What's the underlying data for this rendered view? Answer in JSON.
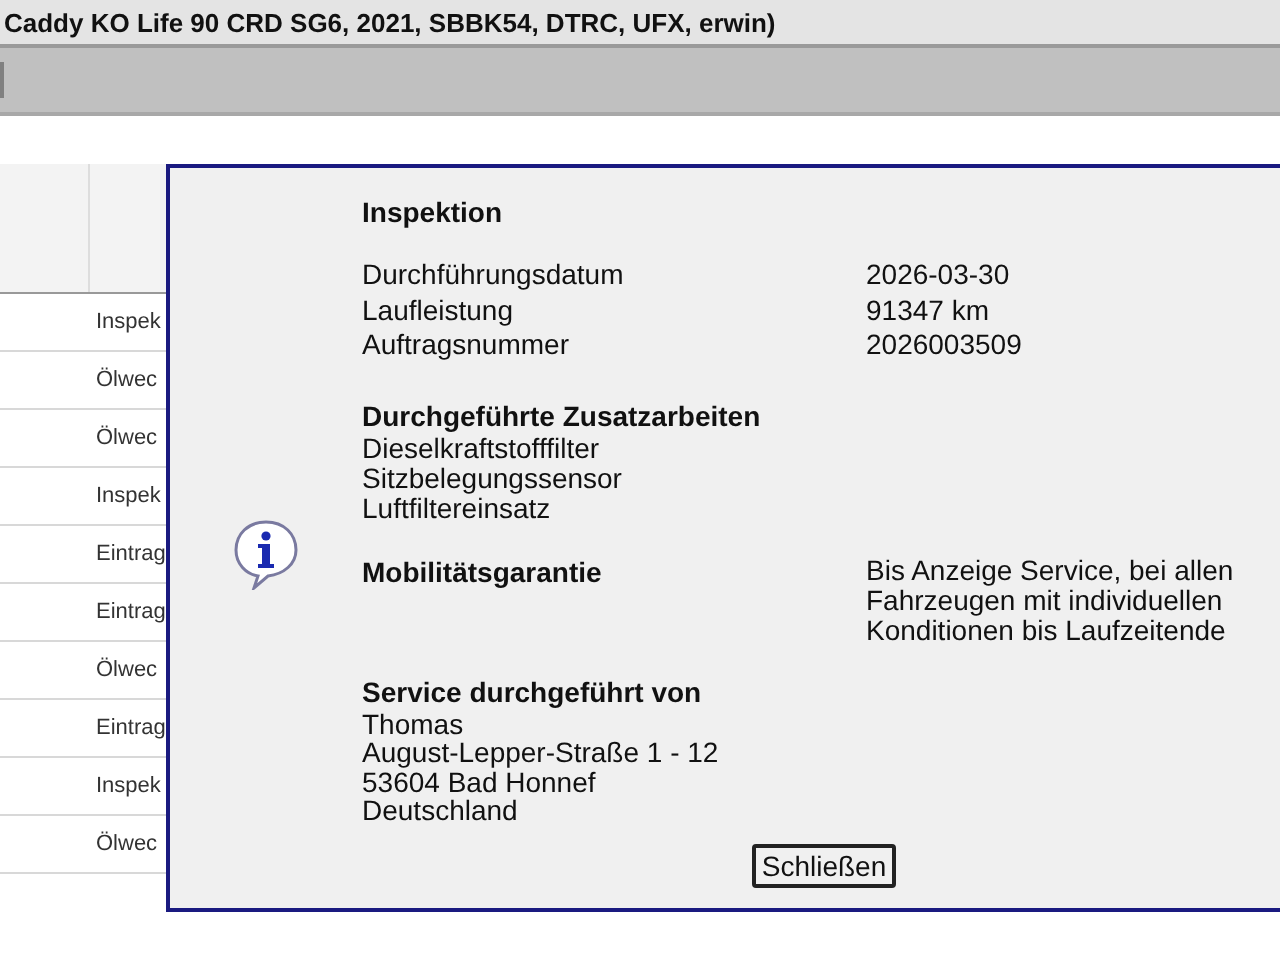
{
  "window": {
    "title": "Caddy KO Life 90 CRD SG6, 2021, SBBK54, DTRC, UFX, erwin)"
  },
  "table": {
    "rows": [
      {
        "entry": "Inspek"
      },
      {
        "entry": "Ölwec"
      },
      {
        "entry": "Ölwec"
      },
      {
        "entry": "Inspek"
      },
      {
        "entry": "Eintrag"
      },
      {
        "entry": "Eintrag"
      },
      {
        "entry": "Ölwec"
      },
      {
        "entry": "Eintrag"
      },
      {
        "entry": "Inspek"
      },
      {
        "entry": "Ölwec"
      }
    ]
  },
  "dialog": {
    "title": "Inspektion",
    "details": [
      {
        "label": "Durchführungsdatum",
        "value": "2026-03-30"
      },
      {
        "label": "Laufleistung",
        "value": "91347 km"
      },
      {
        "label": "Auftragsnummer",
        "value": "2026003509"
      }
    ],
    "extra_work": {
      "heading": "Durchgeführte Zusatzarbeiten",
      "items": [
        "Dieselkraftstofffilter",
        "Sitzbelegungssensor",
        "Luftfiltereinsatz"
      ]
    },
    "mobility": {
      "heading": "Mobilitätsgarantie",
      "value": "Bis Anzeige Service, bei allen Fahrzeugen mit individuellen Konditionen bis Laufzeitende"
    },
    "service": {
      "heading": "Service durchgeführt von",
      "lines": [
        "Thomas",
        "August-Lepper-Straße 1 - 12",
        "53604 Bad Honnef",
        "Deutschland"
      ]
    },
    "button": "Schließen"
  }
}
